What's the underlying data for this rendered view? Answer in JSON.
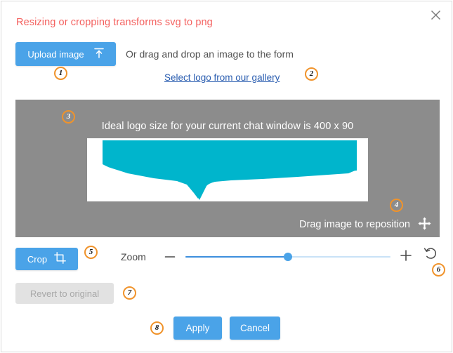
{
  "dialog": {
    "title": "Resizing or cropping transforms svg to png",
    "close_icon": "close-icon"
  },
  "upload": {
    "button_label": "Upload image",
    "button_icon": "upload-icon",
    "drag_hint": "Or drag and drop an image to the form",
    "gallery_link": "Select logo from our gallery"
  },
  "preview": {
    "caption": "Ideal logo size for your current chat window is 400 x 90",
    "reposition_hint": "Drag image to reposition",
    "move_icon": "move-arrows-icon",
    "background_color": "#8c8c8c",
    "logo_color": "#00b5cc",
    "logo_canvas_color": "#ffffff",
    "ideal_width": "400",
    "ideal_height": "90"
  },
  "toolbar": {
    "crop_label": "Crop",
    "crop_icon": "crop-icon",
    "zoom_label": "Zoom",
    "zoom_out_icon": "minus-icon",
    "zoom_in_icon": "plus-icon",
    "reset_icon": "rotate-ccw-icon",
    "zoom_value_percent": "50",
    "revert_label": "Revert to original"
  },
  "footer": {
    "apply_label": "Apply",
    "cancel_label": "Cancel"
  },
  "badges": [
    {
      "n": "1"
    },
    {
      "n": "2"
    },
    {
      "n": "3"
    },
    {
      "n": "4"
    },
    {
      "n": "5"
    },
    {
      "n": "6"
    },
    {
      "n": "7"
    },
    {
      "n": "8"
    }
  ],
  "colors": {
    "accent_blue": "#4aa3e8",
    "title_red": "#f4615f",
    "badge_orange": "#f0932b",
    "link_blue": "#2a5db0",
    "disabled_gray": "#e2e2e2"
  }
}
